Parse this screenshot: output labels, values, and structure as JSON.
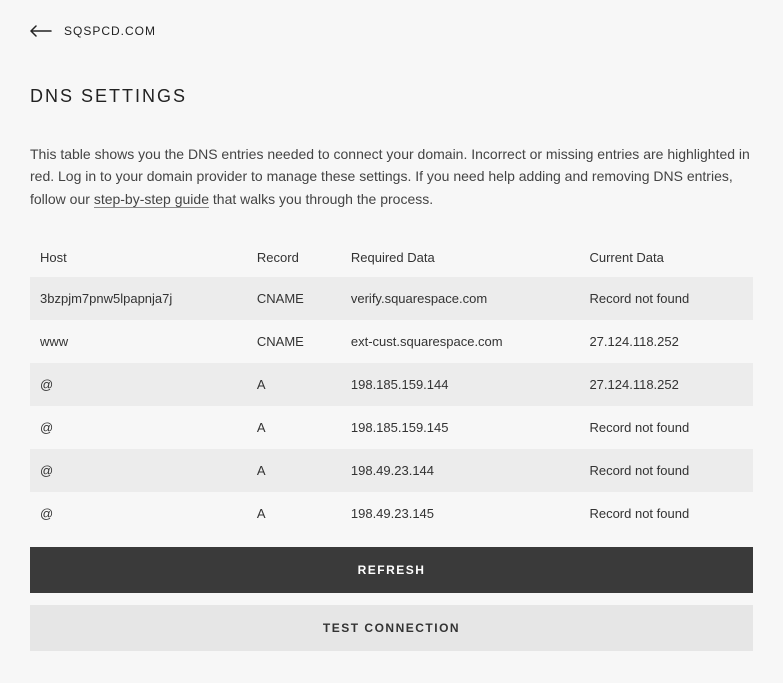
{
  "breadcrumb": "SQSPCD.COM",
  "title": "DNS SETTINGS",
  "description_prefix": "This table shows you the DNS entries needed to connect your domain. Incorrect or missing entries are highlighted in red. Log in to your domain provider to manage these settings. If you need help adding and removing DNS entries, follow our ",
  "description_link": "step-by-step guide",
  "description_suffix": " that walks you through the process.",
  "columns": {
    "host": "Host",
    "record": "Record",
    "required": "Required Data",
    "current": "Current Data"
  },
  "rows": [
    {
      "host": "3bzpjm7pnw5lpapnja7j",
      "record": "CNAME",
      "required": "verify.squarespace.com",
      "current": "Record not found",
      "error": true
    },
    {
      "host": "www",
      "record": "CNAME",
      "required": "ext-cust.squarespace.com",
      "current": "27.124.118.252",
      "error": true
    },
    {
      "host": "@",
      "record": "A",
      "required": "198.185.159.144",
      "current": "27.124.118.252",
      "error": true
    },
    {
      "host": "@",
      "record": "A",
      "required": "198.185.159.145",
      "current": "Record not found",
      "error": true
    },
    {
      "host": "@",
      "record": "A",
      "required": "198.49.23.144",
      "current": "Record not found",
      "error": true
    },
    {
      "host": "@",
      "record": "A",
      "required": "198.49.23.145",
      "current": "Record not found",
      "error": true
    }
  ],
  "buttons": {
    "refresh": "REFRESH",
    "test": "TEST CONNECTION"
  }
}
